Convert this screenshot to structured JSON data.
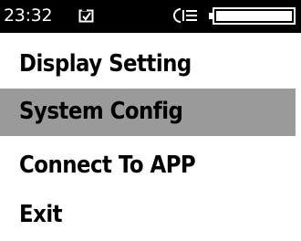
{
  "status_bar": {
    "time": "23:32",
    "notification_icon": "message-icon",
    "flash_icon": "flash-status-icon",
    "battery_icon": "battery-full-icon",
    "battery_level": 1.0
  },
  "menu": {
    "selected_index": 1,
    "items": [
      {
        "label": "Display Setting"
      },
      {
        "label": "System Config"
      },
      {
        "label": "Connect To APP"
      },
      {
        "label": "Exit"
      }
    ]
  },
  "colors": {
    "status_bar_bg": "#000000",
    "status_bar_fg": "#ffffff",
    "highlight": "#9a9a9a",
    "text": "#000000",
    "background": "#ffffff"
  }
}
